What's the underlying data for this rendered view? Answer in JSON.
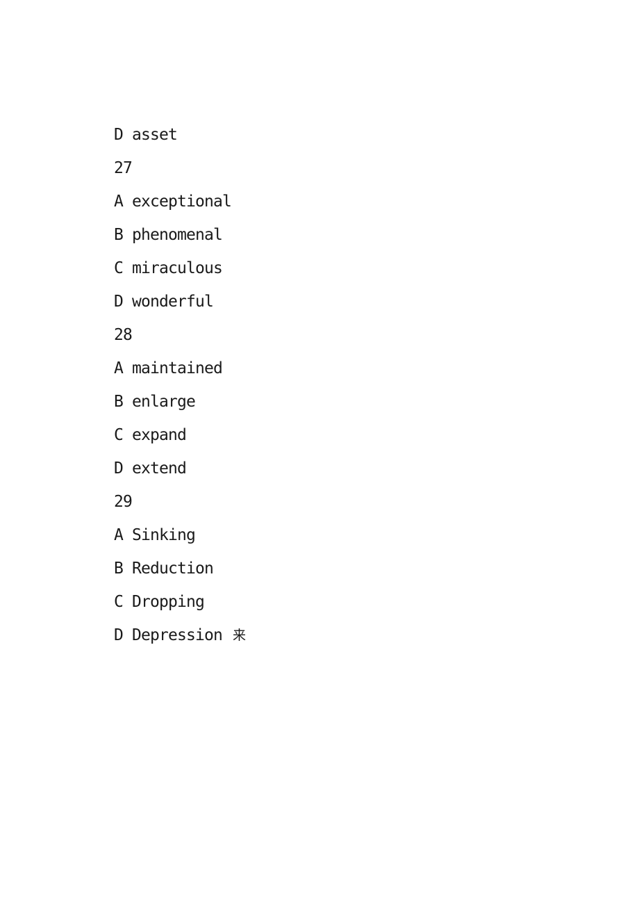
{
  "document": {
    "background_color": "#ffffff",
    "text_color": "#1a1a1a",
    "lines": [
      {
        "id": "line-1",
        "kind": "option",
        "text": "D asset"
      },
      {
        "id": "line-2",
        "kind": "question-number",
        "text": "27"
      },
      {
        "id": "line-3",
        "kind": "option",
        "text": "A exceptional"
      },
      {
        "id": "line-4",
        "kind": "option",
        "text": "B phenomenal"
      },
      {
        "id": "line-5",
        "kind": "option",
        "text": "C miraculous"
      },
      {
        "id": "line-6",
        "kind": "option",
        "text": "D wonderful"
      },
      {
        "id": "line-7",
        "kind": "question-number",
        "text": "28"
      },
      {
        "id": "line-8",
        "kind": "option",
        "text": "A maintained"
      },
      {
        "id": "line-9",
        "kind": "option",
        "text": "B enlarge"
      },
      {
        "id": "line-10",
        "kind": "option",
        "text": "C expand"
      },
      {
        "id": "line-11",
        "kind": "option",
        "text": "D extend"
      },
      {
        "id": "line-12",
        "kind": "question-number",
        "text": "29"
      },
      {
        "id": "line-13",
        "kind": "option",
        "text": "A Sinking"
      },
      {
        "id": "line-14",
        "kind": "option",
        "text": "B Reduction"
      },
      {
        "id": "line-15",
        "kind": "option",
        "text": "C Dropping"
      },
      {
        "id": "line-16",
        "kind": "option",
        "text": "D Depression",
        "trailing_mark": "来"
      }
    ]
  }
}
